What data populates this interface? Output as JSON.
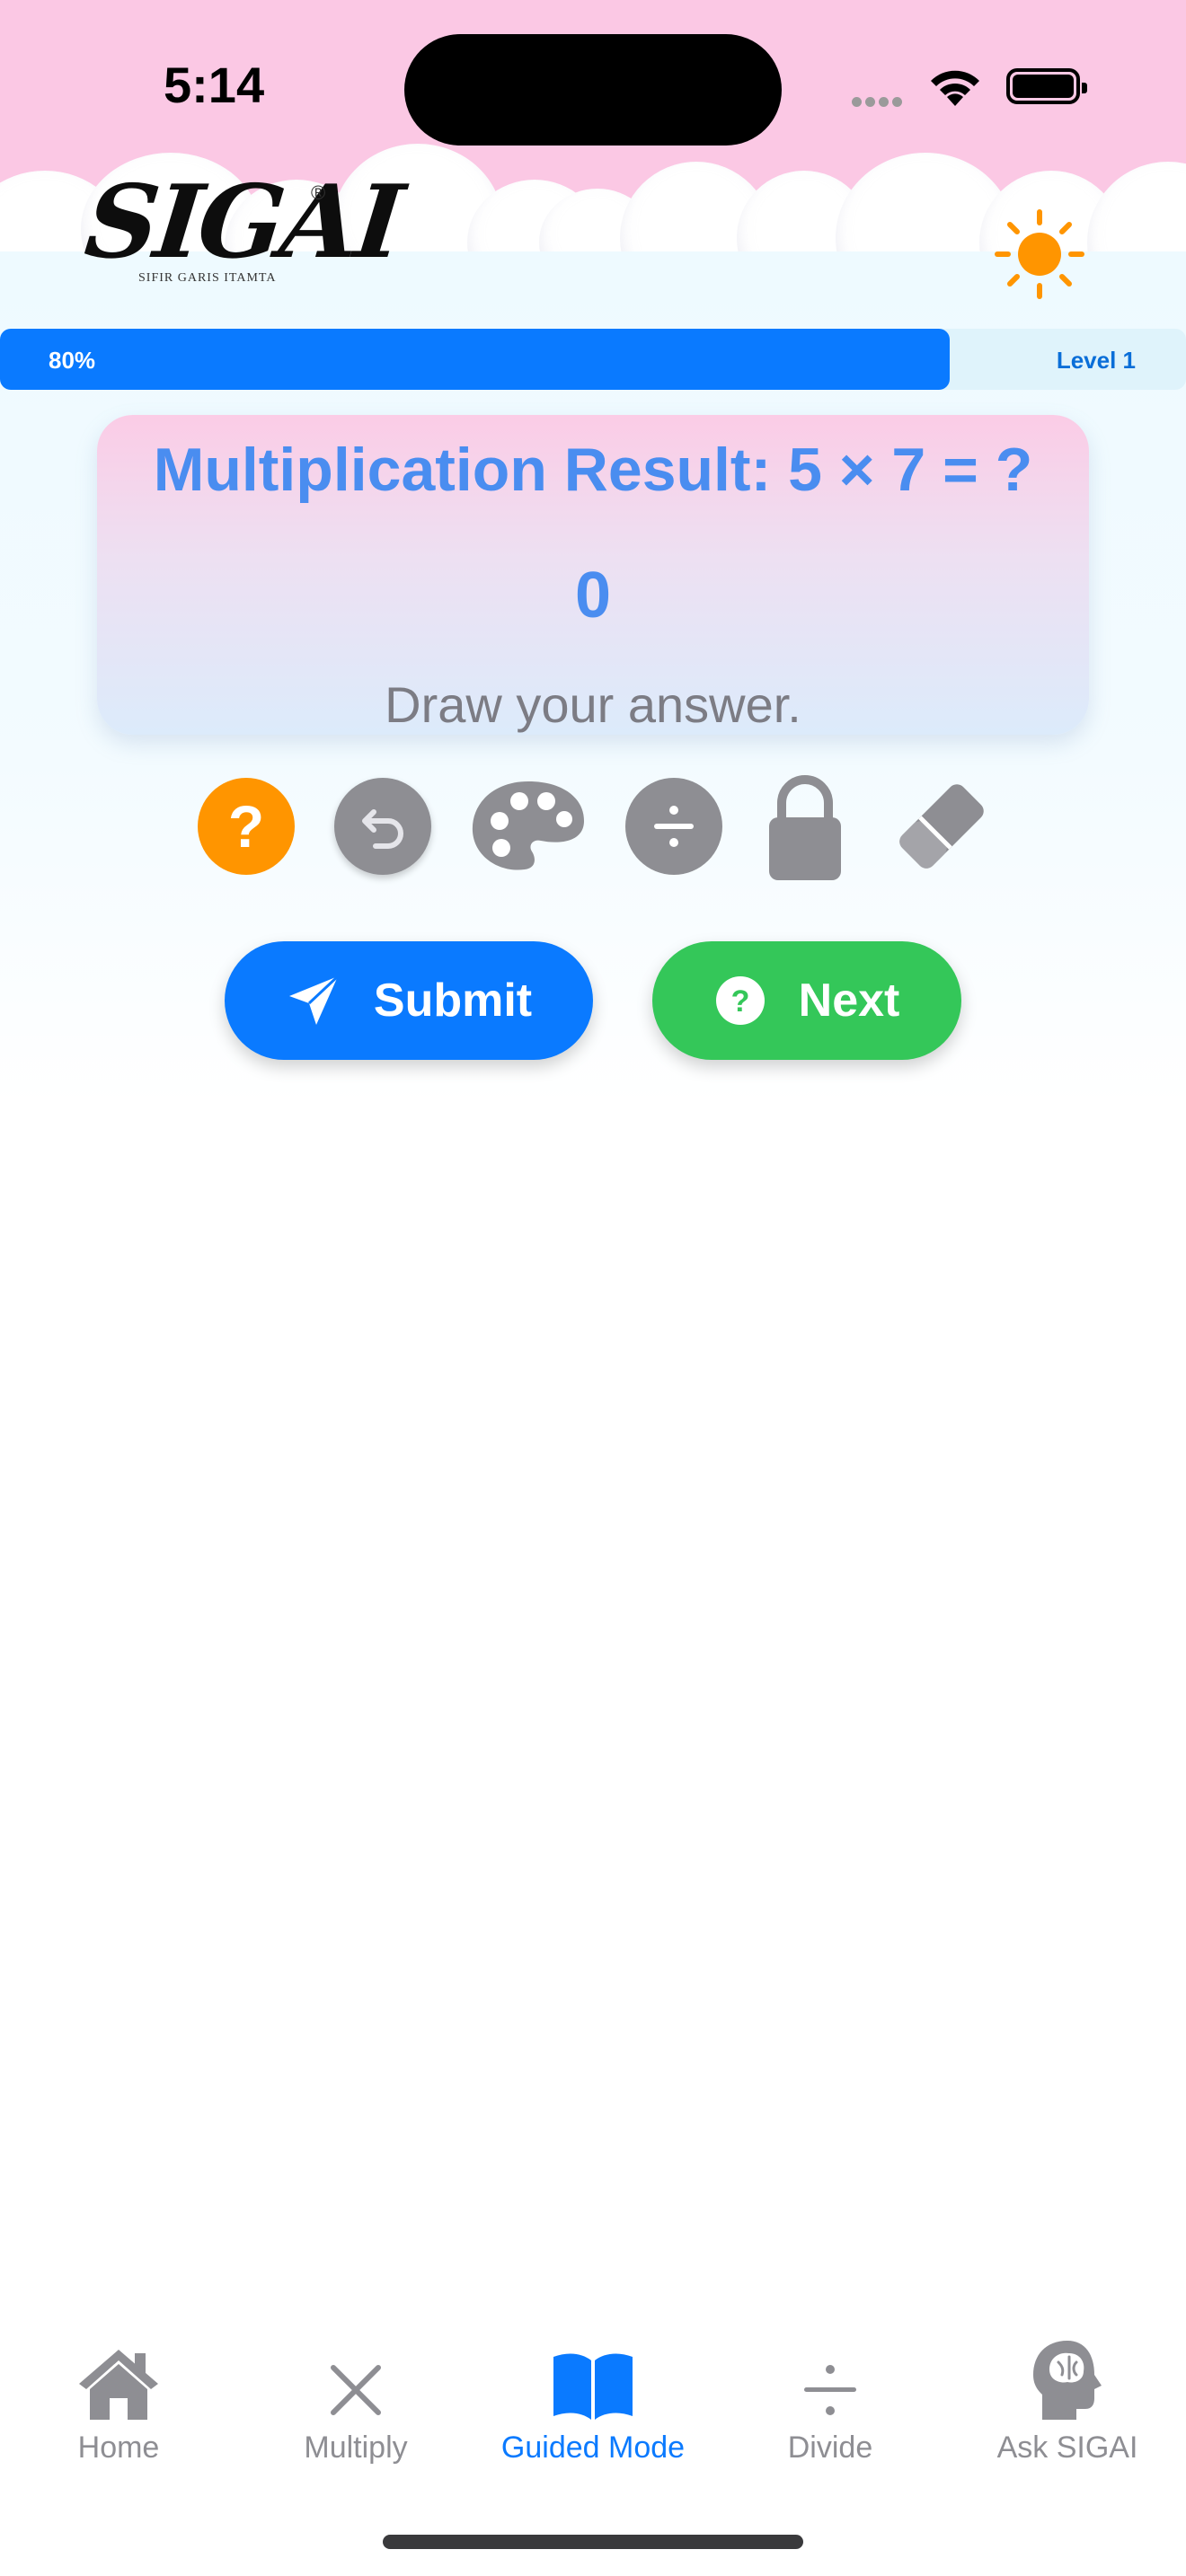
{
  "status_bar": {
    "time": "5:14"
  },
  "header": {
    "logo_text": "SIGAI",
    "logo_subtitle": "SIFIR GARIS ITAMTA",
    "logo_registered": "®",
    "theme_icon": "sun-icon"
  },
  "progress": {
    "percent_label": "80%",
    "value": 0.8,
    "level_label": "Level 1",
    "fill_color": "#0A7AFF"
  },
  "question": {
    "title": "Multiplication Result: 5 × 7 = ?",
    "answer": "0",
    "hint": "Draw your answer."
  },
  "toolbar": {
    "icons": [
      "help-icon",
      "undo-icon",
      "palette-icon",
      "divide-icon",
      "lock-icon",
      "eraser-icon"
    ],
    "help_label": "?"
  },
  "actions": {
    "submit_label": "Submit",
    "next_label": "Next",
    "submit_color": "#0A7AFF",
    "next_color": "#34C759"
  },
  "tab_bar": {
    "tabs": [
      {
        "label": "Home",
        "icon": "house-icon"
      },
      {
        "label": "Multiply",
        "icon": "multiply-icon"
      },
      {
        "label": "Guided Mode",
        "icon": "book-icon",
        "active": true
      },
      {
        "label": "Divide",
        "icon": "divide-icon"
      },
      {
        "label": "Ask SIGAI",
        "icon": "brain-head-icon"
      }
    ]
  }
}
